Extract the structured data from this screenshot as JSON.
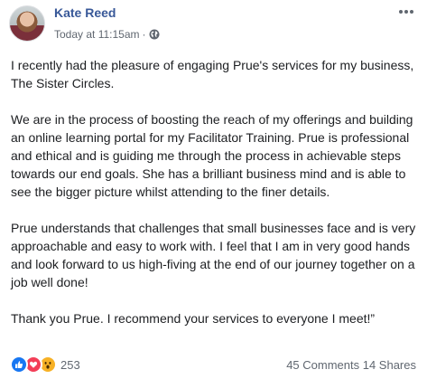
{
  "post": {
    "author": "Kate Reed",
    "timestamp": "Today at 11:15am",
    "separator": "·",
    "privacy_icon": "globe-icon",
    "paragraphs": [
      "I recently had the pleasure of engaging Prue's services for my business, The Sister Circles.",
      "We are in the process of boosting the reach of my offerings and building an online learning portal for my Facilitator Training. Prue is professional and ethical and is guiding me through the process in achievable steps towards our end goals. She has a brilliant business mind and is able to see the bigger picture whilst attending to the finer details.",
      "Prue understands that challenges that small businesses face and is very approachable and easy to work with. I feel that I am in very good hands and look forward to us high-fiving at the end of our journey together on a job well done!",
      "Thank you Prue. I recommend your services to everyone I meet!”"
    ]
  },
  "footer": {
    "reaction_icons": [
      "like-icon",
      "love-icon",
      "wow-icon"
    ],
    "reaction_count": "253",
    "comments": "45 Comments",
    "shares": "14 Shares"
  },
  "colors": {
    "author_link": "#385898",
    "meta_text": "#606770",
    "like": "#1877f2",
    "love": "#f33e58",
    "wow": "#f7b125"
  }
}
